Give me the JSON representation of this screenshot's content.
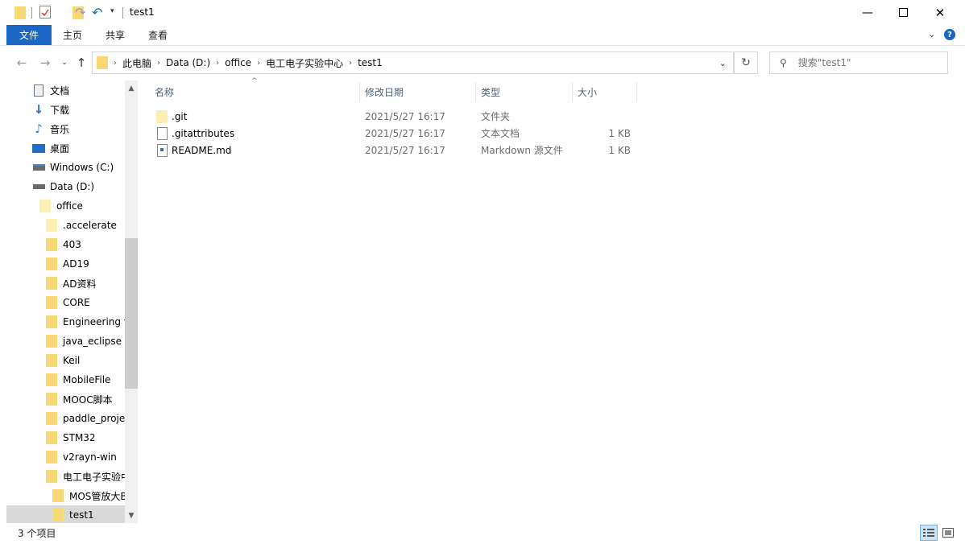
{
  "window": {
    "title": "test1"
  },
  "ribbon": {
    "tabs": [
      "文件",
      "主页",
      "共享",
      "查看"
    ]
  },
  "address": {
    "crumbs": [
      "此电脑",
      "Data (D:)",
      "office",
      "电工电子实验中心",
      "test1"
    ]
  },
  "search": {
    "placeholder": "搜索\"test1\""
  },
  "nav": {
    "items": [
      {
        "label": "文档",
        "icon": "documents-icon"
      },
      {
        "label": "下载",
        "icon": "download-icon"
      },
      {
        "label": "音乐",
        "icon": "music-icon"
      },
      {
        "label": "桌面",
        "icon": "desktop-icon"
      },
      {
        "label": "Windows (C:)",
        "icon": "drive-c-icon"
      },
      {
        "label": "Data (D:)",
        "icon": "drive-d-icon"
      },
      {
        "label": "office",
        "icon": "folder-icon"
      },
      {
        "label": ".accelerate",
        "icon": "folder-icon"
      },
      {
        "label": "403",
        "icon": "folder-icon"
      },
      {
        "label": "AD19",
        "icon": "folder-icon"
      },
      {
        "label": "AD资料",
        "icon": "folder-icon"
      },
      {
        "label": "CORE",
        "icon": "folder-icon"
      },
      {
        "label": "Engineering t",
        "icon": "folder-icon"
      },
      {
        "label": "java_eclipse",
        "icon": "folder-icon"
      },
      {
        "label": "Keil",
        "icon": "folder-icon"
      },
      {
        "label": "MobileFile",
        "icon": "folder-icon"
      },
      {
        "label": "MOOC脚本",
        "icon": "folder-icon"
      },
      {
        "label": "paddle_proje",
        "icon": "folder-icon"
      },
      {
        "label": "STM32",
        "icon": "folder-icon"
      },
      {
        "label": "v2rayn-win",
        "icon": "folder-icon"
      },
      {
        "label": "电工电子实验中",
        "icon": "folder-icon"
      },
      {
        "label": "MOS管放大B",
        "icon": "folder-icon"
      },
      {
        "label": "test1",
        "icon": "folder-icon"
      }
    ]
  },
  "columns": {
    "name": "名称",
    "date": "修改日期",
    "type": "类型",
    "size": "大小"
  },
  "files": [
    {
      "name": ".git",
      "date": "2021/5/27 16:17",
      "type": "文件夹",
      "size": "",
      "icon": "folder-icon"
    },
    {
      "name": ".gitattributes",
      "date": "2021/5/27 16:17",
      "type": "文本文档",
      "size": "1 KB",
      "icon": "text-file-icon"
    },
    {
      "name": "README.md",
      "date": "2021/5/27 16:17",
      "type": "Markdown 源文件",
      "size": "1 KB",
      "icon": "markdown-file-icon"
    }
  ],
  "status": {
    "count": "3 个项目"
  }
}
